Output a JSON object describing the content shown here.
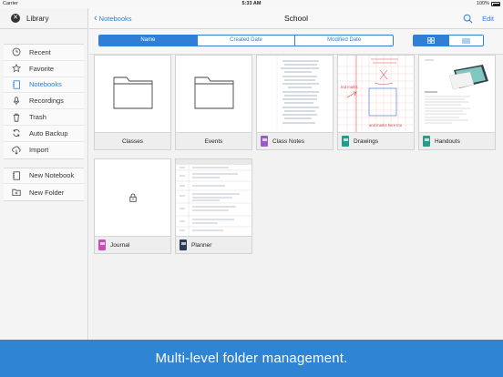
{
  "status_bar": {
    "carrier": "Carrier",
    "time": "5:33 AM",
    "battery": "100%"
  },
  "sidebar": {
    "title": "Library",
    "items": [
      {
        "label": "Recent",
        "icon": "clock-icon",
        "active": false
      },
      {
        "label": "Favorite",
        "icon": "star-icon",
        "active": false
      },
      {
        "label": "Notebooks",
        "icon": "notebook-icon",
        "active": true
      },
      {
        "label": "Recordings",
        "icon": "microphone-icon",
        "active": false
      },
      {
        "label": "Trash",
        "icon": "trash-icon",
        "active": false
      },
      {
        "label": "Auto Backup",
        "icon": "sync-icon",
        "active": false
      },
      {
        "label": "Import",
        "icon": "cloud-download-icon",
        "active": false
      }
    ],
    "actions": [
      {
        "label": "New Notebook",
        "icon": "new-notebook-icon"
      },
      {
        "label": "New Folder",
        "icon": "new-folder-icon"
      }
    ]
  },
  "nav": {
    "back_label": "Notebooks",
    "title": "School",
    "edit_label": "Edit"
  },
  "sort_tabs": [
    {
      "label": "Name",
      "active": true
    },
    {
      "label": "Created Date",
      "active": false
    },
    {
      "label": "Modified Date",
      "active": false
    }
  ],
  "view_modes": [
    {
      "icon": "grid-view-icon",
      "active": true
    },
    {
      "icon": "list-view-icon",
      "active": false
    }
  ],
  "items": [
    {
      "label": "Classes",
      "kind": "folder",
      "cover_color": ""
    },
    {
      "label": "Events",
      "kind": "folder",
      "cover_color": ""
    },
    {
      "label": "Class Notes",
      "kind": "notebook",
      "cover_color": "#9b59c9"
    },
    {
      "label": "Drawings",
      "kind": "notebook",
      "cover_color": "#1f9d8a"
    },
    {
      "label": "Handouts",
      "kind": "notebook",
      "cover_color": "#2a9a8a"
    },
    {
      "label": "Journal",
      "kind": "notebook-locked",
      "cover_color": "#c54fb8"
    },
    {
      "label": "Planner",
      "kind": "notebook",
      "cover_color": "#2b3d55"
    }
  ],
  "drawing_notes": {
    "left": "red marks",
    "bottom": "and marks here too"
  },
  "banner": "Multi-level folder management."
}
